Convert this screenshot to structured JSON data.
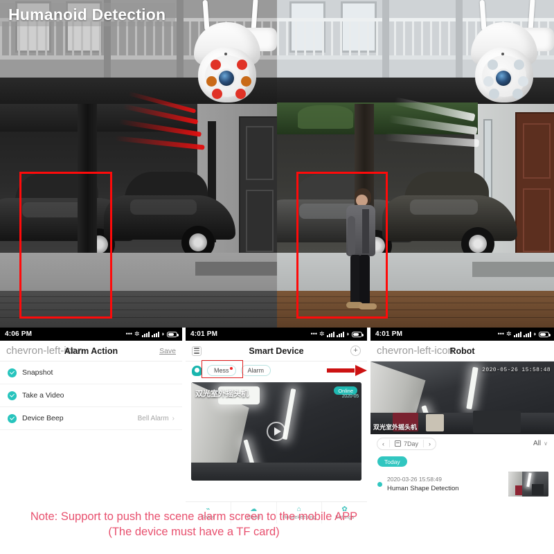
{
  "banner": {
    "title": "Humanoid Detection"
  },
  "photos": {
    "left": {
      "mode": "night-grayscale",
      "detection_box": true,
      "beam_color": "#e01010",
      "led_color": "#e23a2e"
    },
    "right": {
      "mode": "day-color",
      "detection_box": true,
      "beam_color": "#ffffff",
      "led_color": "#dfe6ea"
    }
  },
  "phone1": {
    "status": {
      "time": "4:06 PM",
      "dots": "...",
      "bluetooth": "bluetooth-icon",
      "wifi": "wifi-icon",
      "battery": "battery-icon"
    },
    "nav": {
      "back": "chevron-left-icon",
      "title": "Alarm Action",
      "action": "Save"
    },
    "rows": [
      {
        "label": "Snapshot",
        "checked": true,
        "value": ""
      },
      {
        "label": "Take a Video",
        "checked": true,
        "value": ""
      },
      {
        "label": "Device Beep",
        "checked": true,
        "value": "Bell Alarm",
        "chevron": "›"
      }
    ]
  },
  "phone2": {
    "status": {
      "time": "4:01 PM"
    },
    "nav": {
      "menu": "hamburger-icon",
      "title": "Smart Device",
      "add": "plus-icon"
    },
    "chips": [
      {
        "label": "Mess",
        "badge": true,
        "highlighted": true
      },
      {
        "label": "Alarm",
        "badge": false,
        "highlighted": false
      }
    ],
    "feed": {
      "label": "双光室外摇头机",
      "status_badge": "Online",
      "date": "2020-05",
      "play": "play-icon"
    },
    "tabs": [
      {
        "label": "Share",
        "icon": "share-icon",
        "glyph": "≤"
      },
      {
        "label": "Cloud",
        "icon": "cloud-icon",
        "glyph": "☁"
      },
      {
        "label": "Housekeeping",
        "icon": "home-icon",
        "glyph": "⌂"
      },
      {
        "label": "Settings",
        "icon": "gear-icon",
        "glyph": "⚙"
      }
    ]
  },
  "phone3": {
    "status": {
      "time": "4:01 PM"
    },
    "nav": {
      "back": "chevron-left-icon",
      "title": "Robot"
    },
    "feed": {
      "timestamp": "2020-05-26 15:58:48",
      "label": "双光室外摇头机"
    },
    "datepicker": {
      "prev": "‹",
      "calendar": "calendar-icon",
      "label": "7Day",
      "next": "›",
      "filter": "All",
      "filter_chevron": "∨"
    },
    "today_badge": "Today",
    "events": [
      {
        "time": "2020-03-26 15:58:49",
        "title": "Human Shape Detection",
        "thumbnail": "event-thumbnail"
      }
    ]
  },
  "note": {
    "line1": "Note: Support to push the scene alarm screen to the mobile APP",
    "line2": "(The device must have a TF card)"
  },
  "colors": {
    "accent_teal": "#31c6c0",
    "alert_red": "#e01010",
    "note_pink": "#e8506e"
  }
}
